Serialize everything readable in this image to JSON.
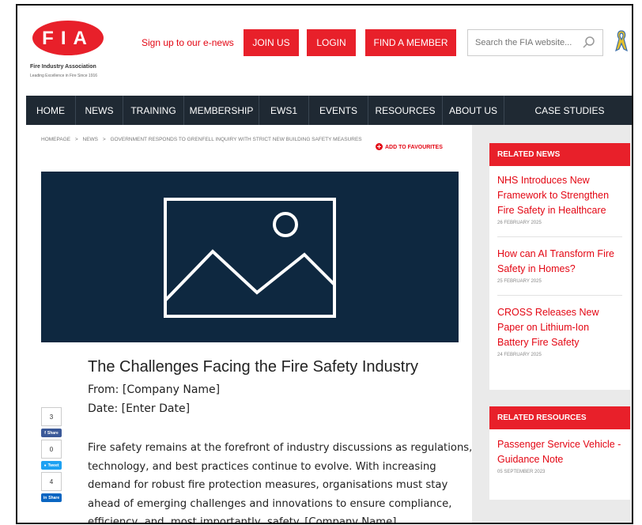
{
  "header": {
    "logo_letters": "FIA",
    "logo_name": "Fire Industry Association",
    "logo_tagline": "Leading Excellence in Fire Since 1916",
    "signup_text": "Sign up to our e-news",
    "join_label": "JOIN US",
    "login_label": "LOGIN",
    "find_member_label": "FIND A MEMBER",
    "search_placeholder": "Search the FIA website..."
  },
  "nav": {
    "items": [
      {
        "label": "HOME"
      },
      {
        "label": "NEWS"
      },
      {
        "label": "TRAINING"
      },
      {
        "label": "MEMBERSHIP"
      },
      {
        "label": "EWS1"
      },
      {
        "label": "EVENTS"
      },
      {
        "label": "RESOURCES"
      },
      {
        "label": "ABOUT US"
      },
      {
        "label": "CASE STUDIES"
      }
    ]
  },
  "breadcrumb": {
    "home": "HOMEPAGE",
    "news": "NEWS",
    "current": "GOVERNMENT RESPONDS TO GRENFELL INQUIRY WITH STRICT NEW BUILDING SAFETY MEASURES",
    "separator": ">"
  },
  "favourites_label": "ADD TO FAVOURITES",
  "article": {
    "title": "The Challenges Facing the Fire Safety Industry",
    "from": "From: [Company Name]",
    "date": "Date: [Enter Date]",
    "body": "Fire safety remains at the forefront of industry discussions as regulations, technology, and best practices continue to evolve. With increasing demand for robust fire protection measures, organisations must stay ahead of emerging challenges and innovations to ensure compliance, efficiency, and, most importantly, safety. [Company Name]"
  },
  "share": {
    "facebook_count": "3",
    "facebook_label": "Share",
    "twitter_count": "0",
    "twitter_label": "Tweet",
    "linkedin_count": "4",
    "linkedin_label": "Share"
  },
  "sidebar": {
    "related_news_title": "RELATED NEWS",
    "related_news": [
      {
        "title": "NHS Introduces New Framework to Strengthen Fire Safety in Healthcare",
        "date": "26 FEBRUARY 2025"
      },
      {
        "title": "How can AI Transform Fire Safety in Homes?",
        "date": "25 FEBRUARY 2025"
      },
      {
        "title": "CROSS Releases New Paper on Lithium-Ion Battery Fire Safety",
        "date": "24 FEBRUARY 2025"
      }
    ],
    "related_resources_title": "RELATED RESOURCES",
    "related_resources": [
      {
        "title": "Passenger Service Vehicle - Guidance Note",
        "date": "05 SEPTEMBER 2023"
      }
    ]
  },
  "colors": {
    "brand_red": "#e8202a",
    "nav_bg": "#1f2933",
    "hero_bg": "#0e2840",
    "sidebar_bg": "#eaeaea"
  }
}
